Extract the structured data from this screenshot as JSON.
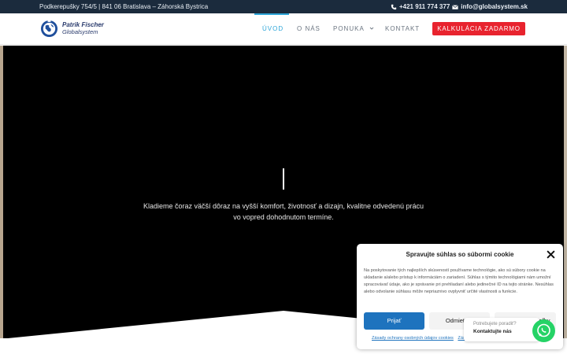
{
  "topbar": {
    "address": "Podkerepušky 754/5 | 841 06 Bratislava – Záhorská Bystrica",
    "phone": "+421 911 774 377",
    "email": "info@globalsystem.sk",
    "phone_icon": "phone-icon",
    "email_icon": "envelope-icon"
  },
  "logo": {
    "name": "Patrik Fischer",
    "sub": "Globalsystem"
  },
  "nav": {
    "items": [
      {
        "label": "ÚVOD",
        "active": true
      },
      {
        "label": "O NÁS",
        "active": false
      },
      {
        "label": "PONUKA",
        "active": false,
        "has_dropdown": true
      },
      {
        "label": "KONTAKT",
        "active": false
      }
    ],
    "cta_label": "KALKULÁCIA ZADARMO"
  },
  "hero": {
    "line1": "Kladieme čoraz väčší dôraz na vyšší komfort, životnosť a dizajn, kvalitne odvedenú prácu",
    "line2": "vo vopred dohodnutom termíne."
  },
  "cookie": {
    "title": "Spravujte súhlas so súbormi cookie",
    "body": "Na poskytovanie tých najlepších skúseností používame technológie, ako sú súbory cookie na ukladanie a/alebo prístup k informáciám o zariadení. Súhlas s týmito technológiami nám umožní spracovávať údaje, ako je správanie pri prehliadaní alebo jedinečné ID na tejto stránke. Nesúhlas alebo odvolanie súhlasu môže nepriaznivo ovplyvniť určité vlastnosti a funkcie.",
    "accept_label": "Prijať",
    "deny_label": "Odmietnuť",
    "prefs_label": "Zobraziť predvoľby",
    "link_privacy": "Zásady ochrany osobných údajov cookies",
    "link_other": "Zás"
  },
  "chat": {
    "question": "Potrebujete poradiť?",
    "answer": "Kontaktujte nás"
  },
  "colors": {
    "topbar_bg": "#1b2b3d",
    "accent": "#2fa6d9",
    "cta": "#e8232e",
    "cookie_primary": "#1e73be",
    "whatsapp": "#25d366"
  }
}
